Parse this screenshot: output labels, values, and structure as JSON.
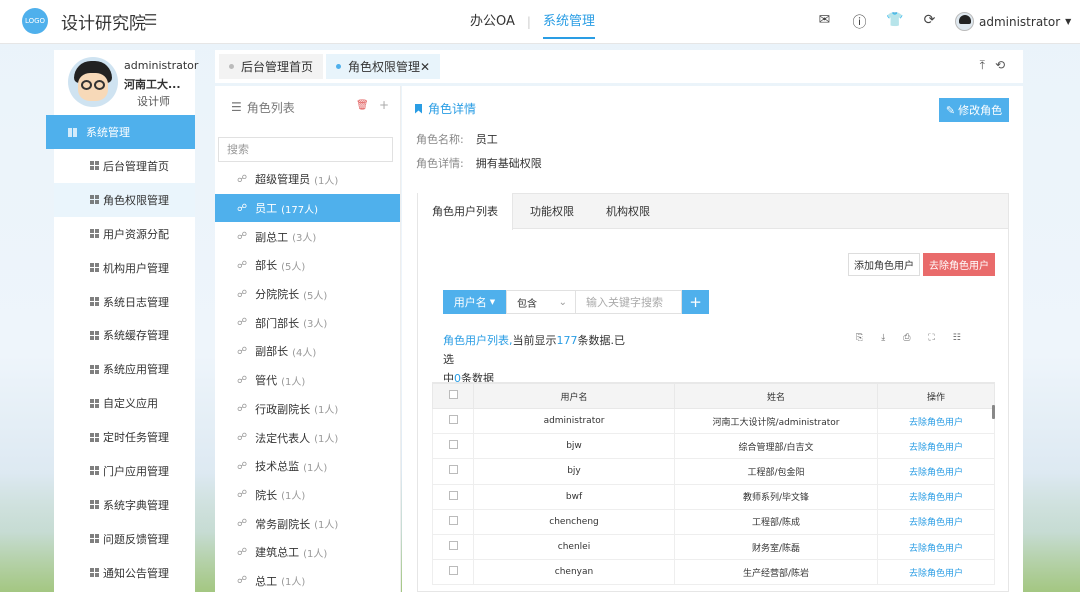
{
  "header": {
    "logo": "LOGO",
    "title": "设计研究院",
    "nav": [
      "办公OA",
      "系统管理"
    ],
    "active_nav": 1,
    "user": "administrator"
  },
  "profile": {
    "name": "administrator",
    "org": "河南工大...",
    "role": "设计师"
  },
  "sidebar": {
    "group": "系统管理",
    "items": [
      {
        "label": "后台管理首页"
      },
      {
        "label": "角色权限管理",
        "active": true
      },
      {
        "label": "用户资源分配"
      },
      {
        "label": "机构用户管理"
      },
      {
        "label": "系统日志管理"
      },
      {
        "label": "系统缓存管理"
      },
      {
        "label": "系统应用管理"
      },
      {
        "label": "自定义应用"
      },
      {
        "label": "定时任务管理"
      },
      {
        "label": "门户应用管理"
      },
      {
        "label": "系统字典管理"
      },
      {
        "label": "问题反馈管理"
      },
      {
        "label": "通知公告管理"
      }
    ]
  },
  "tabs": [
    {
      "label": "后台管理首页"
    },
    {
      "label": "角色权限管理✕",
      "active": true
    }
  ],
  "role_panel": {
    "title": "角色列表",
    "search_placeholder": "搜索",
    "roles": [
      {
        "name": "超级管理员",
        "count": "(1人)"
      },
      {
        "name": "员工",
        "count": "(177人)",
        "active": true
      },
      {
        "name": "副总工",
        "count": "(3人)"
      },
      {
        "name": "部长",
        "count": "(5人)"
      },
      {
        "name": "分院院长",
        "count": "(5人)"
      },
      {
        "name": "部门部长",
        "count": "(3人)"
      },
      {
        "name": "副部长",
        "count": "(4人)"
      },
      {
        "name": "管代",
        "count": "(1人)"
      },
      {
        "name": "行政副院长",
        "count": "(1人)"
      },
      {
        "name": "法定代表人",
        "count": "(1人)"
      },
      {
        "name": "技术总监",
        "count": "(1人)"
      },
      {
        "name": "院长",
        "count": "(1人)"
      },
      {
        "name": "常务副院长",
        "count": "(1人)"
      },
      {
        "name": "建筑总工",
        "count": "(1人)"
      },
      {
        "name": "总工",
        "count": "(1人)"
      }
    ]
  },
  "detail": {
    "title": "角色详情",
    "edit_button": "修改角色",
    "name_label": "角色名称:",
    "name_value": "员工",
    "desc_label": "角色详情:",
    "desc_value": "拥有基础权限",
    "subtabs": [
      "角色用户列表",
      "功能权限",
      "机构权限"
    ],
    "add_button": "添加角色用户",
    "remove_button": "去除角色用户",
    "search_field": "用户名",
    "search_op": "包含",
    "search_placeholder": "输入关键字搜索",
    "info_prefix": "角色用户列表,",
    "info_mid": "当前显示",
    "info_count": "177",
    "info_suffix": "条数据.已选",
    "info_line2a": "中",
    "info_selected": "0",
    "info_line2b": "条数据",
    "columns": [
      "用户名",
      "姓名",
      "操作"
    ],
    "rows": [
      {
        "user": "administrator",
        "name": "河南工大设计院/administrator",
        "op": "去除角色用户"
      },
      {
        "user": "bjw",
        "name": "综合管理部/白吉文",
        "op": "去除角色用户"
      },
      {
        "user": "bjy",
        "name": "工程部/包金阳",
        "op": "去除角色用户"
      },
      {
        "user": "bwf",
        "name": "教师系列/毕文锋",
        "op": "去除角色用户"
      },
      {
        "user": "chencheng",
        "name": "工程部/陈成",
        "op": "去除角色用户"
      },
      {
        "user": "chenlei",
        "name": "财务室/陈磊",
        "op": "去除角色用户"
      },
      {
        "user": "chenyan",
        "name": "生产经营部/陈岩",
        "op": "去除角色用户"
      }
    ]
  }
}
